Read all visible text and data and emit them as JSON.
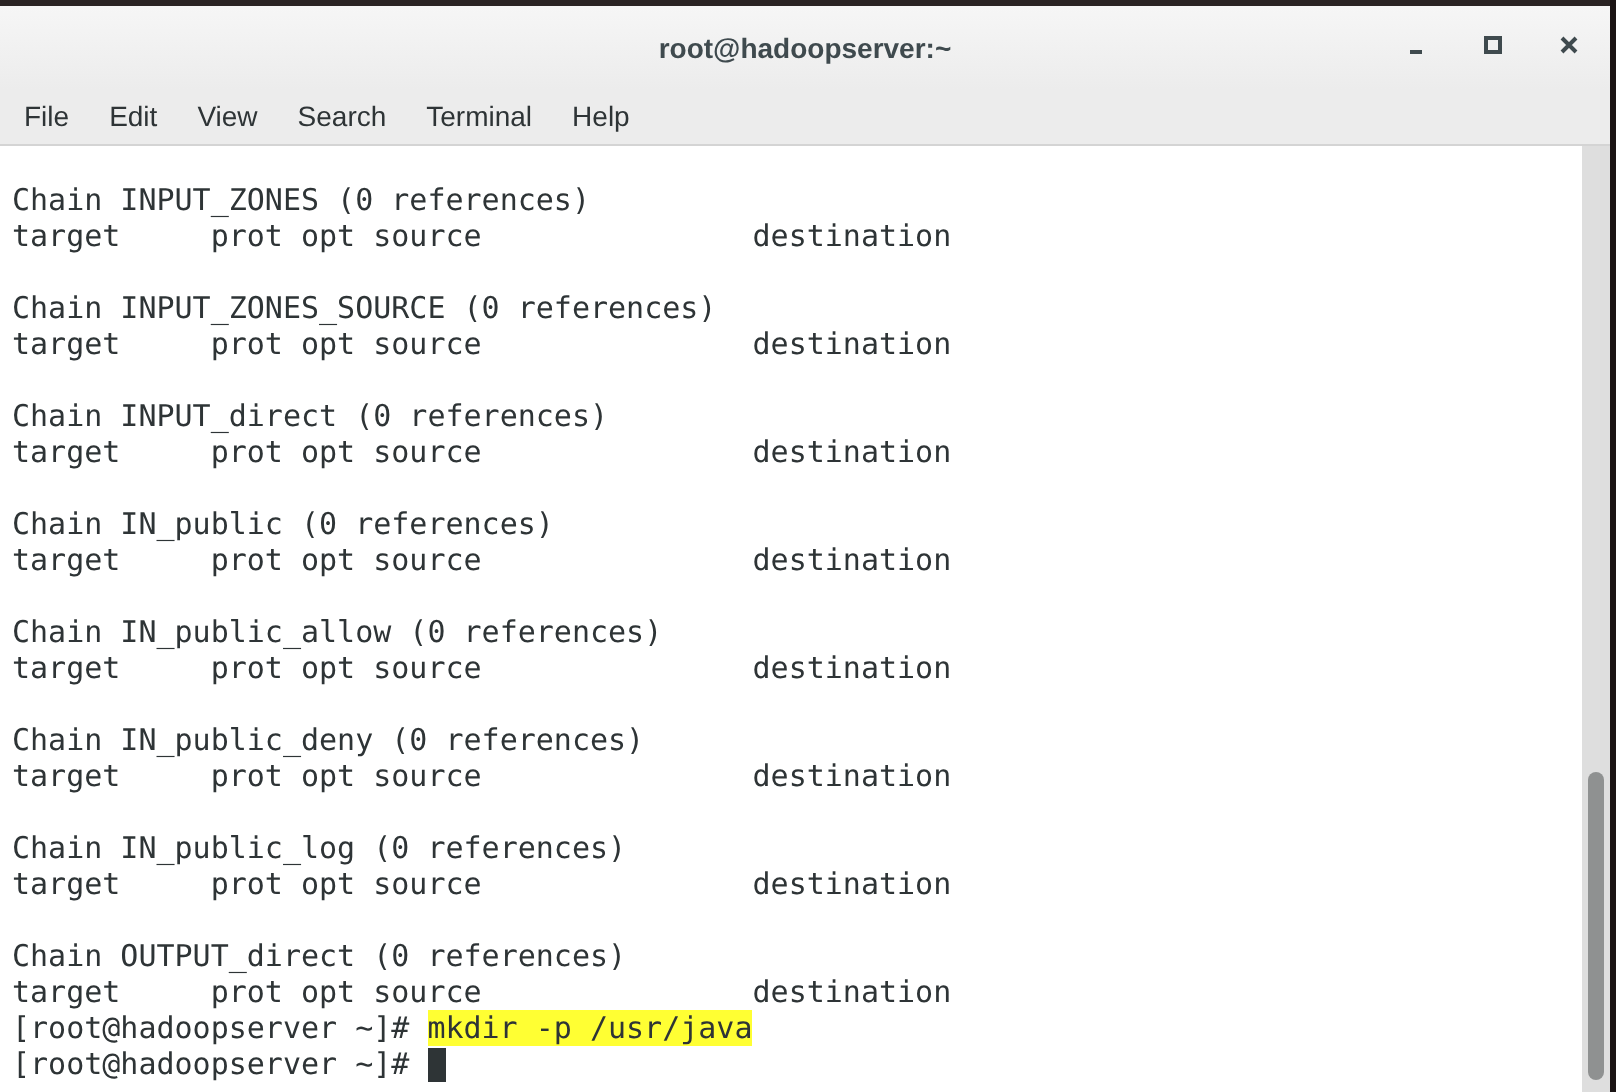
{
  "window": {
    "title": "root@hadoopserver:~"
  },
  "menu": [
    "File",
    "Edit",
    "View",
    "Search",
    "Terminal",
    "Help"
  ],
  "terminal": {
    "lines": [
      {
        "kind": "output",
        "text": "Chain INPUT_ZONES (0 references)"
      },
      {
        "kind": "output",
        "text": "target     prot opt source               destination"
      },
      {
        "kind": "blank"
      },
      {
        "kind": "output",
        "text": "Chain INPUT_ZONES_SOURCE (0 references)"
      },
      {
        "kind": "output",
        "text": "target     prot opt source               destination"
      },
      {
        "kind": "blank"
      },
      {
        "kind": "output",
        "text": "Chain INPUT_direct (0 references)"
      },
      {
        "kind": "output",
        "text": "target     prot opt source               destination"
      },
      {
        "kind": "blank"
      },
      {
        "kind": "output",
        "text": "Chain IN_public (0 references)"
      },
      {
        "kind": "output",
        "text": "target     prot opt source               destination"
      },
      {
        "kind": "blank"
      },
      {
        "kind": "output",
        "text": "Chain IN_public_allow (0 references)"
      },
      {
        "kind": "output",
        "text": "target     prot opt source               destination"
      },
      {
        "kind": "blank"
      },
      {
        "kind": "output",
        "text": "Chain IN_public_deny (0 references)"
      },
      {
        "kind": "output",
        "text": "target     prot opt source               destination"
      },
      {
        "kind": "blank"
      },
      {
        "kind": "output",
        "text": "Chain IN_public_log (0 references)"
      },
      {
        "kind": "output",
        "text": "target     prot opt source               destination"
      },
      {
        "kind": "blank"
      },
      {
        "kind": "output",
        "text": "Chain OUTPUT_direct (0 references)"
      },
      {
        "kind": "output",
        "text": "target     prot opt source               destination"
      },
      {
        "kind": "prompt",
        "prompt": "[root@hadoopserver ~]#",
        "command": "mkdir -p /usr/java",
        "highlighted": true,
        "cursor": false
      },
      {
        "kind": "prompt",
        "prompt": "[root@hadoopserver ~]#",
        "cursor": true
      }
    ]
  }
}
